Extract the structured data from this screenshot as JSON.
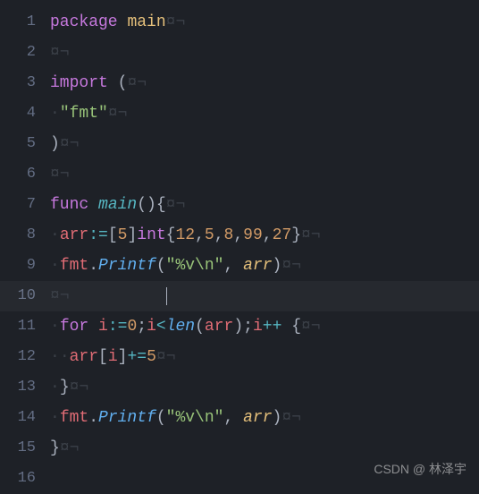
{
  "watermark": "CSDN @ 林泽宇",
  "caret_line": 10,
  "highlighted_line": 10,
  "gutter": {
    "start": 1,
    "end": 16
  },
  "whitespace": {
    "space": "·",
    "eol": "¤¬"
  },
  "lines": [
    {
      "n": 1,
      "tokens": [
        {
          "cls": "tok-kw",
          "t": "package"
        },
        {
          "cls": "tok-plain",
          "t": " "
        },
        {
          "cls": "tok-pkg",
          "t": "main"
        },
        {
          "cls": "ws",
          "t": "¤¬"
        }
      ]
    },
    {
      "n": 2,
      "tokens": [
        {
          "cls": "ws",
          "t": "¤¬"
        }
      ]
    },
    {
      "n": 3,
      "tokens": [
        {
          "cls": "tok-kw",
          "t": "import"
        },
        {
          "cls": "tok-plain",
          "t": " "
        },
        {
          "cls": "tok-punc",
          "t": "("
        },
        {
          "cls": "ws",
          "t": "¤¬"
        }
      ]
    },
    {
      "n": 4,
      "tokens": [
        {
          "cls": "ws",
          "t": "·"
        },
        {
          "cls": "tok-str",
          "t": "\"fmt\""
        },
        {
          "cls": "ws",
          "t": "¤¬"
        }
      ]
    },
    {
      "n": 5,
      "tokens": [
        {
          "cls": "tok-punc",
          "t": ")"
        },
        {
          "cls": "ws",
          "t": "¤¬"
        }
      ]
    },
    {
      "n": 6,
      "tokens": [
        {
          "cls": "ws",
          "t": "¤¬"
        }
      ]
    },
    {
      "n": 7,
      "tokens": [
        {
          "cls": "tok-kw",
          "t": "func"
        },
        {
          "cls": "tok-plain",
          "t": " "
        },
        {
          "cls": "tok-main",
          "t": "main"
        },
        {
          "cls": "tok-punc",
          "t": "()"
        },
        {
          "cls": "tok-punc",
          "t": "{"
        },
        {
          "cls": "ws",
          "t": "¤¬"
        }
      ]
    },
    {
      "n": 8,
      "tokens": [
        {
          "cls": "ws",
          "t": "·"
        },
        {
          "cls": "tok-var",
          "t": "arr"
        },
        {
          "cls": "tok-op",
          "t": ":="
        },
        {
          "cls": "tok-punc",
          "t": "["
        },
        {
          "cls": "tok-num",
          "t": "5"
        },
        {
          "cls": "tok-punc",
          "t": "]"
        },
        {
          "cls": "tok-type",
          "t": "int"
        },
        {
          "cls": "tok-punc",
          "t": "{"
        },
        {
          "cls": "tok-num",
          "t": "12"
        },
        {
          "cls": "tok-punc",
          "t": ","
        },
        {
          "cls": "tok-num",
          "t": "5"
        },
        {
          "cls": "tok-punc",
          "t": ","
        },
        {
          "cls": "tok-num",
          "t": "8"
        },
        {
          "cls": "tok-punc",
          "t": ","
        },
        {
          "cls": "tok-num",
          "t": "99"
        },
        {
          "cls": "tok-punc",
          "t": ","
        },
        {
          "cls": "tok-num",
          "t": "27"
        },
        {
          "cls": "tok-punc",
          "t": "}"
        },
        {
          "cls": "ws",
          "t": "¤¬"
        }
      ]
    },
    {
      "n": 9,
      "tokens": [
        {
          "cls": "ws",
          "t": "·"
        },
        {
          "cls": "tok-var",
          "t": "fmt"
        },
        {
          "cls": "tok-punc",
          "t": "."
        },
        {
          "cls": "tok-func",
          "t": "Printf"
        },
        {
          "cls": "tok-punc",
          "t": "("
        },
        {
          "cls": "tok-str",
          "t": "\"%v\\n\""
        },
        {
          "cls": "tok-punc",
          "t": ","
        },
        {
          "cls": "tok-plain",
          "t": " "
        },
        {
          "cls": "tok-param",
          "t": "arr"
        },
        {
          "cls": "tok-punc",
          "t": ")"
        },
        {
          "cls": "ws",
          "t": "¤¬"
        }
      ]
    },
    {
      "n": 10,
      "tokens": [
        {
          "cls": "ws",
          "t": "¤¬"
        }
      ]
    },
    {
      "n": 11,
      "tokens": [
        {
          "cls": "ws",
          "t": "·"
        },
        {
          "cls": "tok-kw",
          "t": "for"
        },
        {
          "cls": "tok-plain",
          "t": " "
        },
        {
          "cls": "tok-var",
          "t": "i"
        },
        {
          "cls": "tok-op",
          "t": ":="
        },
        {
          "cls": "tok-num",
          "t": "0"
        },
        {
          "cls": "tok-punc",
          "t": ";"
        },
        {
          "cls": "tok-var",
          "t": "i"
        },
        {
          "cls": "tok-op",
          "t": "<"
        },
        {
          "cls": "tok-func",
          "t": "len"
        },
        {
          "cls": "tok-punc",
          "t": "("
        },
        {
          "cls": "tok-var",
          "t": "arr"
        },
        {
          "cls": "tok-punc",
          "t": ")"
        },
        {
          "cls": "tok-punc",
          "t": ";"
        },
        {
          "cls": "tok-var",
          "t": "i"
        },
        {
          "cls": "tok-op",
          "t": "++"
        },
        {
          "cls": "tok-plain",
          "t": " "
        },
        {
          "cls": "tok-punc",
          "t": "{"
        },
        {
          "cls": "ws",
          "t": "¤¬"
        }
      ]
    },
    {
      "n": 12,
      "tokens": [
        {
          "cls": "ws",
          "t": "·"
        },
        {
          "cls": "ws",
          "t": "·"
        },
        {
          "cls": "tok-var",
          "t": "arr"
        },
        {
          "cls": "tok-punc",
          "t": "["
        },
        {
          "cls": "tok-var",
          "t": "i"
        },
        {
          "cls": "tok-punc",
          "t": "]"
        },
        {
          "cls": "tok-op",
          "t": "+="
        },
        {
          "cls": "tok-num",
          "t": "5"
        },
        {
          "cls": "ws",
          "t": "¤¬"
        }
      ]
    },
    {
      "n": 13,
      "tokens": [
        {
          "cls": "ws",
          "t": "·"
        },
        {
          "cls": "tok-punc",
          "t": "}"
        },
        {
          "cls": "ws",
          "t": "¤¬"
        }
      ]
    },
    {
      "n": 14,
      "tokens": [
        {
          "cls": "ws",
          "t": "·"
        },
        {
          "cls": "tok-var",
          "t": "fmt"
        },
        {
          "cls": "tok-punc",
          "t": "."
        },
        {
          "cls": "tok-func",
          "t": "Printf"
        },
        {
          "cls": "tok-punc",
          "t": "("
        },
        {
          "cls": "tok-str",
          "t": "\"%v\\n\""
        },
        {
          "cls": "tok-punc",
          "t": ","
        },
        {
          "cls": "tok-plain",
          "t": " "
        },
        {
          "cls": "tok-param",
          "t": "arr"
        },
        {
          "cls": "tok-punc",
          "t": ")"
        },
        {
          "cls": "ws",
          "t": "¤¬"
        }
      ]
    },
    {
      "n": 15,
      "tokens": [
        {
          "cls": "tok-punc",
          "t": "}"
        },
        {
          "cls": "ws",
          "t": "¤¬"
        }
      ]
    },
    {
      "n": 16,
      "tokens": []
    }
  ]
}
